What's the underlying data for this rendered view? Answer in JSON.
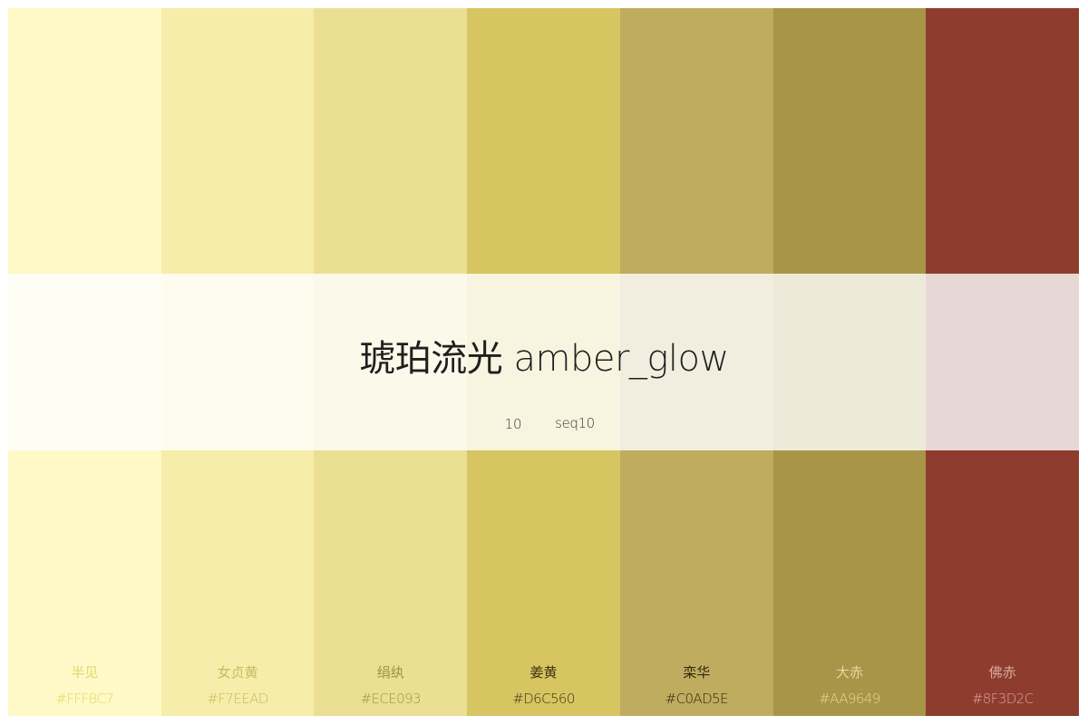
{
  "palette": {
    "title": "琥珀流光 amber_glow",
    "count": "10",
    "type": "seq10",
    "swatches": [
      {
        "name": "半见",
        "hex": "#FFFBC7",
        "color": "#FEF9C6",
        "text_color": "#E2D86A"
      },
      {
        "name": "女贞黄",
        "hex": "#F7EEAD",
        "color": "#F6EDAB",
        "text_color": "#C9BA5C"
      },
      {
        "name": "绢纨",
        "hex": "#ECE093",
        "color": "#EBDF93",
        "text_color": "#9E9446"
      },
      {
        "name": "姜黄",
        "hex": "#D6C560",
        "color": "#D6C561",
        "text_color": "#3C3413"
      },
      {
        "name": "栾华",
        "hex": "#C0AD5E",
        "color": "#BFAC5E",
        "text_color": "#2E2810"
      },
      {
        "name": "大赤",
        "hex": "#AA9649",
        "color": "#A99548",
        "text_color": "#E4D89A"
      },
      {
        "name": "佛赤",
        "hex": "#8F3D2C",
        "color": "#8E3C2E",
        "text_color": "#D9A89B"
      }
    ]
  }
}
